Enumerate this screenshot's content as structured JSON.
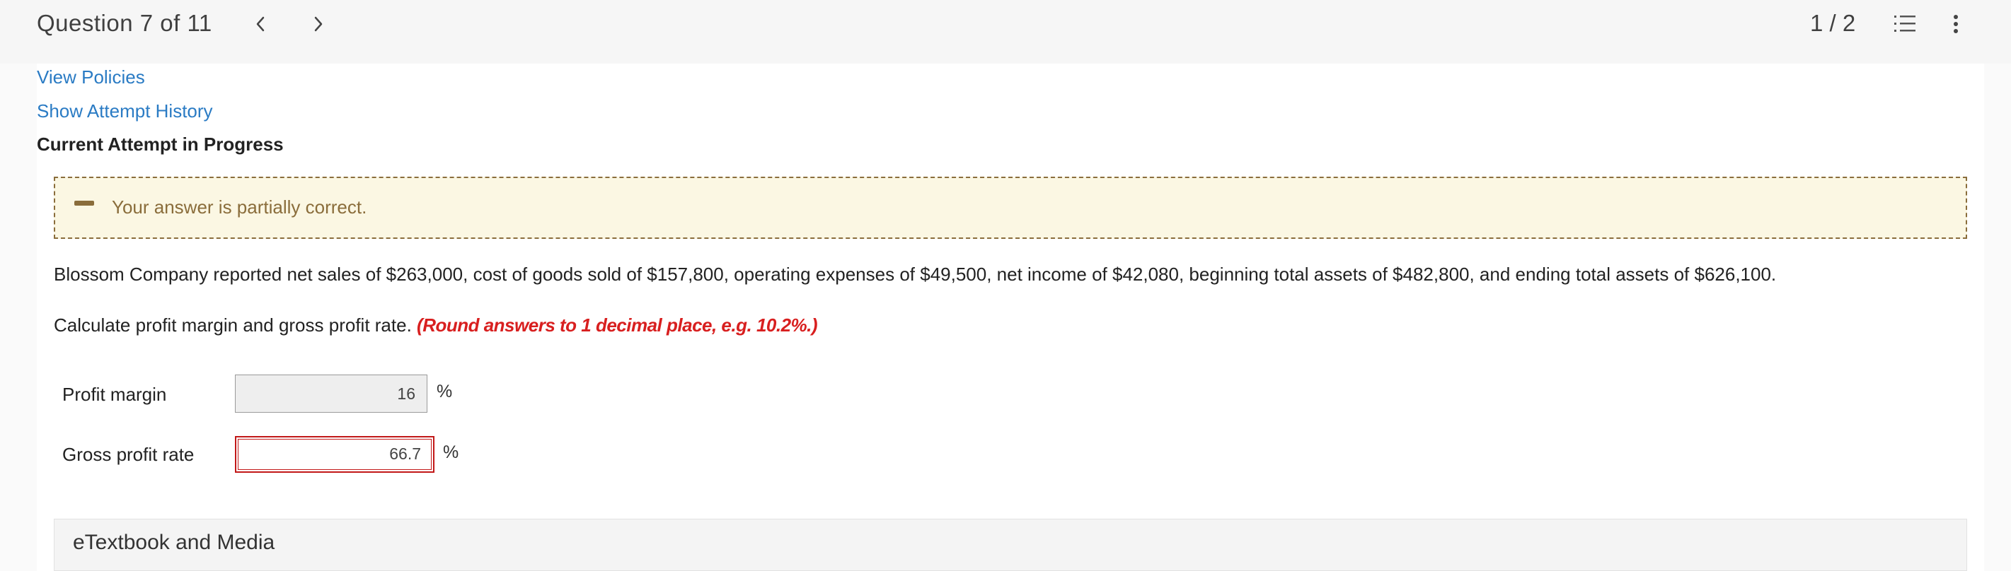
{
  "header": {
    "question_title": "Question 7 of 11",
    "page_counter": "1 / 2"
  },
  "links": {
    "view_policies": "View Policies",
    "show_attempt_history": "Show Attempt History"
  },
  "attempt_status": "Current Attempt in Progress",
  "feedback": {
    "message": "Your answer is partially correct."
  },
  "problem": {
    "text": "Blossom Company reported net sales of $263,000, cost of goods sold of $157,800, operating expenses of $49,500, net income of $42,080, beginning total assets of $482,800, and ending total assets of $626,100.",
    "instruction": "Calculate profit margin and gross profit rate.",
    "instruction_note": "(Round answers to 1 decimal place, e.g. 10.2%.)"
  },
  "answers": [
    {
      "label": "Profit margin",
      "value": "16",
      "unit": "%"
    },
    {
      "label": "Gross profit rate",
      "value": "66.7",
      "unit": "%"
    }
  ],
  "etextbook": {
    "label": "eTextbook and Media"
  },
  "icons": {
    "prev": "chevron-left-icon",
    "next": "chevron-right-icon",
    "list": "numbered-list-icon",
    "more": "more-vertical-icon",
    "feedback": "partial-correct-dash-icon"
  },
  "colors": {
    "link": "#2a7bc4",
    "feedback_bg": "#fbf7e3",
    "feedback_text": "#8a6d3b",
    "note_red": "#d81f1f",
    "error_border": "#c21818"
  }
}
